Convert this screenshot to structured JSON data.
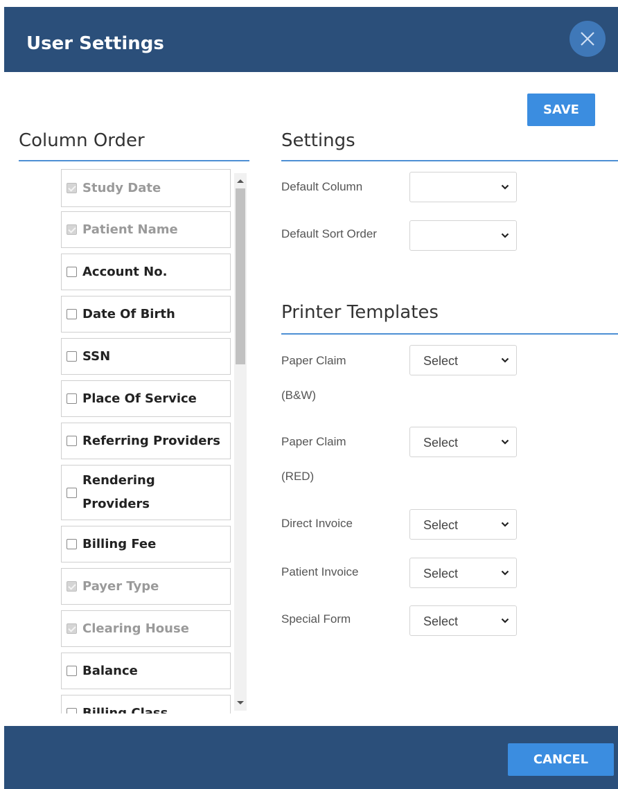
{
  "header": {
    "title": "User Settings"
  },
  "toolbar": {
    "save_label": "SAVE",
    "cancel_label": "CANCEL"
  },
  "column_order": {
    "title": "Column Order",
    "items": [
      {
        "label": "Study Date",
        "checked": true,
        "disabled": true
      },
      {
        "label": "Patient Name",
        "checked": true,
        "disabled": true
      },
      {
        "label": "Account No.",
        "checked": false,
        "disabled": false
      },
      {
        "label": "Date Of Birth",
        "checked": false,
        "disabled": false
      },
      {
        "label": "SSN",
        "checked": false,
        "disabled": false
      },
      {
        "label": "Place Of Service",
        "checked": false,
        "disabled": false
      },
      {
        "label": "Referring Providers",
        "checked": false,
        "disabled": false
      },
      {
        "label": "Rendering Providers",
        "checked": false,
        "disabled": false
      },
      {
        "label": "Billing Fee",
        "checked": false,
        "disabled": false
      },
      {
        "label": "Payer Type",
        "checked": true,
        "disabled": true
      },
      {
        "label": "Clearing House",
        "checked": true,
        "disabled": true
      },
      {
        "label": "Balance",
        "checked": false,
        "disabled": false
      },
      {
        "label": "Billing Class",
        "checked": false,
        "disabled": false
      }
    ]
  },
  "settings": {
    "title": "Settings",
    "default_column": {
      "label": "Default Column",
      "value": ""
    },
    "default_sort_order": {
      "label": "Default Sort Order",
      "value": ""
    }
  },
  "printer_templates": {
    "title": "Printer Templates",
    "paper_claim_bw": {
      "label": "Paper Claim (B&W)",
      "value": "Select"
    },
    "paper_claim_red": {
      "label": "Paper Claim (RED)",
      "value": "Select"
    },
    "direct_invoice": {
      "label": "Direct Invoice",
      "value": "Select"
    },
    "patient_invoice": {
      "label": "Patient Invoice",
      "value": "Select"
    },
    "special_form": {
      "label": "Special Form",
      "value": "Select"
    }
  },
  "colors": {
    "header_bg": "#2b4f7a",
    "accent": "#3b8de0",
    "rule": "#4c8fd4"
  }
}
